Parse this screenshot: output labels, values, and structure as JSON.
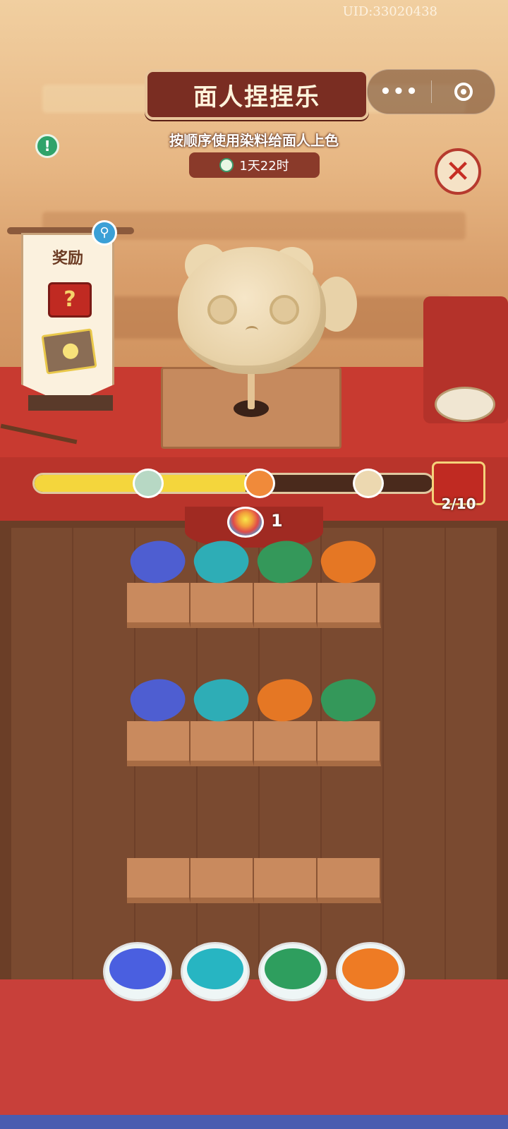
{
  "header": {
    "uid_text": "UID:33020438",
    "title": "面人捏捏乐",
    "subtitle": "按顺序使用染料给面人上色",
    "timer": "1天22时",
    "menu_icon": "more-dots-icon",
    "target_icon": "target-icon"
  },
  "reward": {
    "title": "奖励",
    "search_icon": "magnifier-icon"
  },
  "progress": {
    "fraction": 0.53,
    "count": "2/10"
  },
  "mixing_bowl": {
    "count": "1"
  },
  "colors": {
    "blue": "#4a5fe0",
    "cyan": "#27b5c2",
    "green": "#2e9e5e",
    "orange": "#ee7b24"
  },
  "shelves": [
    {
      "slots": [
        "blue",
        "cyan",
        "green",
        "orange"
      ]
    },
    {
      "slots": [
        "blue",
        "cyan",
        "orange",
        "green"
      ]
    },
    {
      "slots": []
    }
  ],
  "dye_bowls": [
    "blue",
    "cyan",
    "green",
    "orange"
  ]
}
